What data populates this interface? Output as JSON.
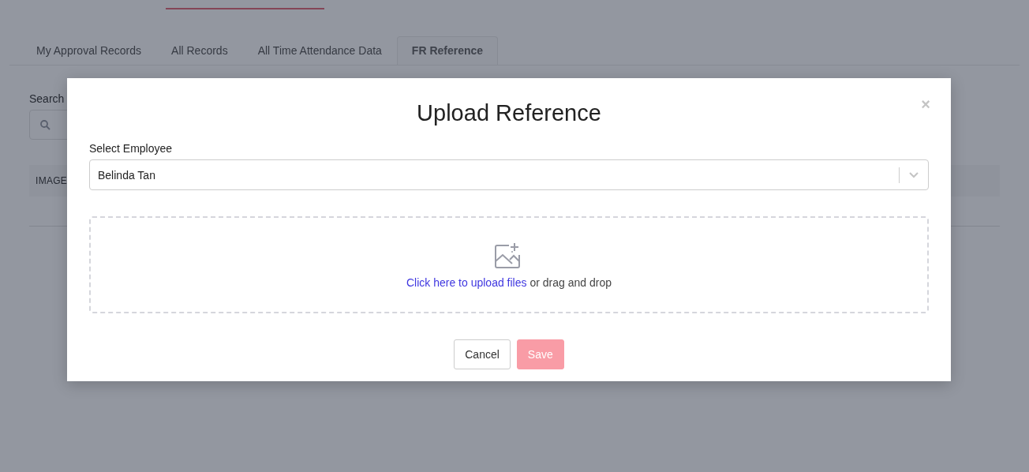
{
  "tabs": [
    {
      "label": "My Approval Records",
      "selected": false
    },
    {
      "label": "All Records",
      "selected": false
    },
    {
      "label": "All Time Attendance Data",
      "selected": false
    },
    {
      "label": "FR Reference",
      "selected": true
    }
  ],
  "search": {
    "label": "Search"
  },
  "table": {
    "columns": [
      "IMAGE"
    ]
  },
  "modal": {
    "title": "Upload Reference",
    "close": "×",
    "employee_label": "Select Employee",
    "employee_value": "Belinda Tan",
    "upload_link": "Click here to upload files",
    "upload_text": "or drag and drop",
    "buttons": [
      {
        "label": "Cancel",
        "kind": "secondary",
        "disabled": false
      },
      {
        "label": "Save",
        "kind": "primary",
        "disabled": true
      }
    ]
  }
}
